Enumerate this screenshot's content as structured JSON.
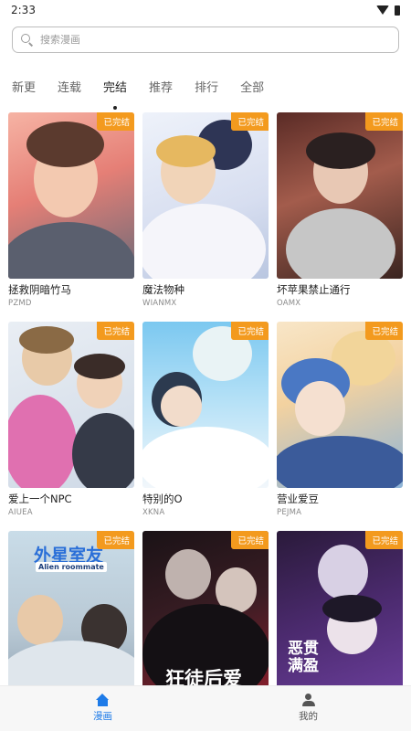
{
  "status_bar": {
    "time": "2:33"
  },
  "search": {
    "placeholder": "搜索漫画"
  },
  "tabs": [
    {
      "label": "新更",
      "active": false
    },
    {
      "label": "连载",
      "active": false
    },
    {
      "label": "完结",
      "active": true
    },
    {
      "label": "推荐",
      "active": false
    },
    {
      "label": "排行",
      "active": false
    },
    {
      "label": "全部",
      "active": false
    }
  ],
  "badge_color": "#f39a1e",
  "accent_color": "#1e7be8",
  "comics": [
    {
      "title": "拯救阴暗竹马",
      "author": "PZMD",
      "badge": "已完结"
    },
    {
      "title": "魔法物种",
      "author": "WIANMX",
      "badge": "已完结"
    },
    {
      "title": "坏苹果禁止通行",
      "author": "OAMX",
      "badge": "已完结"
    },
    {
      "title": "爱上一个NPC",
      "author": "AIUEA",
      "badge": "已完结"
    },
    {
      "title": "特别的O",
      "author": "XKNA",
      "badge": "已完结"
    },
    {
      "title": "营业爱豆",
      "author": "PEJMA",
      "badge": "已完结"
    },
    {
      "title": "",
      "author": "",
      "badge": "已完结",
      "cover_text": "外星室友",
      "cover_subtext": "Alien roommate"
    },
    {
      "title": "",
      "author": "",
      "badge": "已完结",
      "cover_text": "狂徒后爱"
    },
    {
      "title": "",
      "author": "",
      "badge": "已完结",
      "cover_text": "恶贯满盈"
    }
  ],
  "bottom_nav": [
    {
      "label": "漫画",
      "icon": "home-icon",
      "active": true
    },
    {
      "label": "我的",
      "icon": "user-icon",
      "active": false
    }
  ]
}
